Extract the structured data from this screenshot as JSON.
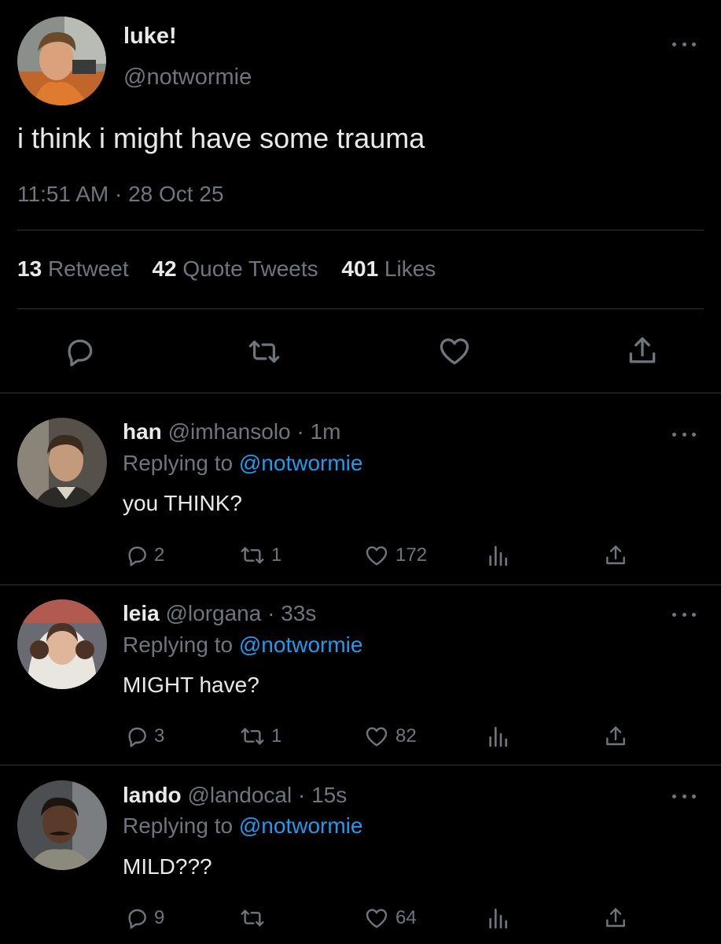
{
  "main_tweet": {
    "display_name": "luke!",
    "handle": "@notwormie",
    "text": "i think i might have some trauma",
    "timestamp": "11:51 AM · 28 Oct 25",
    "stats": {
      "retweets_count": "13",
      "retweets_label": "Retweet",
      "quotes_count": "42",
      "quotes_label": "Quote Tweets",
      "likes_count": "401",
      "likes_label": "Likes"
    }
  },
  "replies": [
    {
      "display_name": "han",
      "handle": "@imhansolo",
      "time": "· 1m",
      "replying_label": "Replying to",
      "replying_handle": "@notwormie",
      "text": "you THINK?",
      "reply_count": "2",
      "retweet_count": "1",
      "like_count": "172"
    },
    {
      "display_name": "leia",
      "handle": "@lorgana",
      "time": "· 33s",
      "replying_label": "Replying to",
      "replying_handle": "@notwormie",
      "text": "MIGHT have?",
      "reply_count": "3",
      "retweet_count": "1",
      "like_count": "82"
    },
    {
      "display_name": "lando",
      "handle": "@landocal",
      "time": "· 15s",
      "replying_label": "Replying to",
      "replying_handle": "@notwormie",
      "text": "MILD???",
      "reply_count": "9",
      "retweet_count": "",
      "like_count": "64"
    }
  ],
  "colors": {
    "background": "#000000",
    "text": "#e7e9ea",
    "muted": "#6e767d",
    "link": "#1d9bf0",
    "divider": "#2f3336"
  },
  "icons": [
    "more-icon",
    "reply-icon",
    "retweet-icon",
    "like-icon",
    "analytics-icon",
    "share-icon"
  ]
}
